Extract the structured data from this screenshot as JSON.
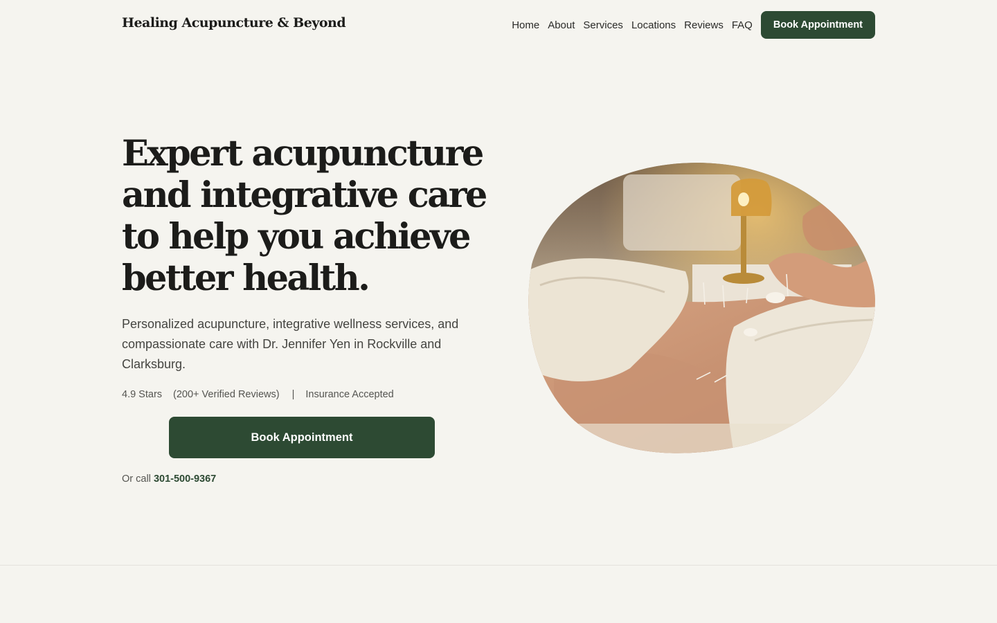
{
  "header": {
    "logo": "Healing Acupuncture & Beyond",
    "nav": [
      "Home",
      "About",
      "Services",
      "Locations",
      "Reviews",
      "FAQ"
    ],
    "cta": "Book Appointment"
  },
  "hero": {
    "title": "Expert acupuncture and integrative care to help you achieve better health.",
    "subtitle": "Personalized acupuncture, integrative wellness services, and compassionate care with Dr. Jennifer Yen in Rockville and Clarksburg.",
    "rating": "4.9 Stars",
    "reviews": "(200+ Verified Reviews)",
    "separator": "|",
    "insurance": "Insurance Accepted",
    "cta": "Book Appointment",
    "call_prefix": "Or call",
    "phone": "301-500-9367"
  },
  "colors": {
    "background": "#f5f4ef",
    "accent": "#2d4a33",
    "text": "#1c1c1a"
  }
}
